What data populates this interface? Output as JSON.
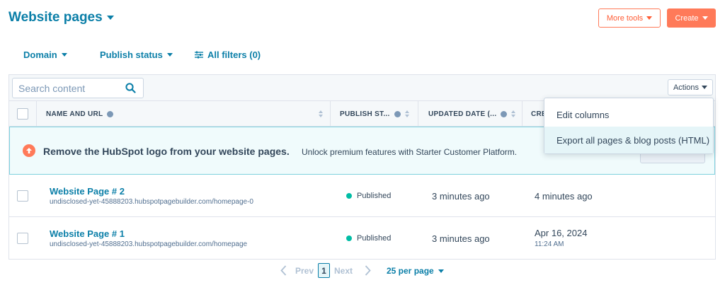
{
  "header": {
    "title": "Website pages",
    "more_tools_label": "More tools",
    "create_label": "Create"
  },
  "filters": {
    "domain": "Domain",
    "publish_status": "Publish status",
    "all_filters": "All filters (0)"
  },
  "search": {
    "placeholder": "Search content"
  },
  "actions_label": "Actions",
  "columns": {
    "name_url": "NAME AND URL",
    "publish_status": "PUBLISH ST...",
    "updated_date": "UPDATED DATE (...",
    "created": "CRE"
  },
  "banner": {
    "title": "Remove the HubSpot logo from your website pages.",
    "subtitle": "Unlock premium features with Starter Customer Platform."
  },
  "rows": [
    {
      "name": "Website Page # 2",
      "url": "undisclosed-yet-45888203.hubspotpagebuilder.com/homepage-0",
      "status": "Published",
      "updated": "3 minutes ago",
      "created": "4 minutes ago",
      "created_time": ""
    },
    {
      "name": "Website Page # 1",
      "url": "undisclosed-yet-45888203.hubspotpagebuilder.com/homepage",
      "status": "Published",
      "updated": "3 minutes ago",
      "created": "Apr 16, 2024",
      "created_time": "11:24 AM"
    }
  ],
  "actions_menu": {
    "items": [
      "Edit columns",
      "Export all pages & blog posts (HTML)"
    ]
  },
  "pagination": {
    "prev": "Prev",
    "page": "1",
    "next": "Next",
    "per_page": "25 per page"
  },
  "colors": {
    "accent": "#0b7fa8",
    "primary_button": "#ff7a59",
    "published": "#00bda5"
  }
}
